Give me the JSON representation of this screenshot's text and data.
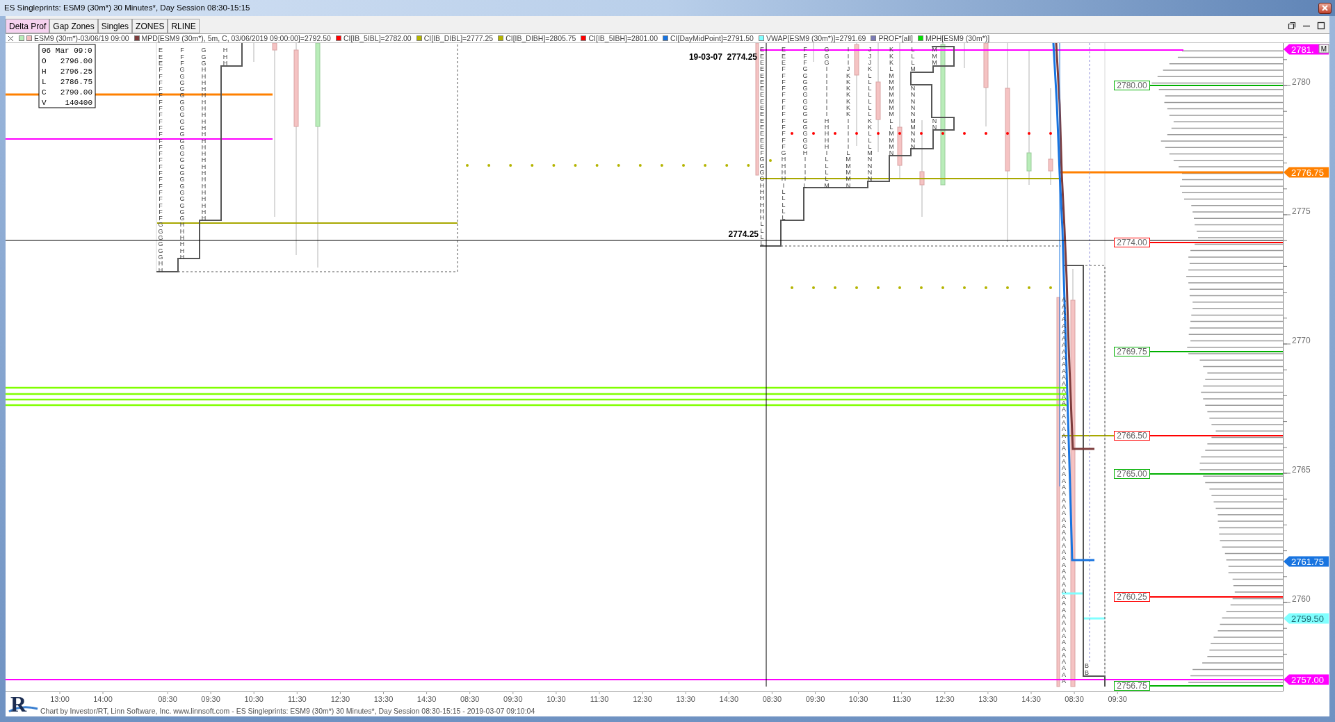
{
  "window": {
    "title": "ES Singleprints: ESM9 (30m*) 30 Minutes*, Day Session 08:30-15:15"
  },
  "toolbar": {
    "buttons": [
      {
        "label": "Delta Prof",
        "selected": true
      },
      {
        "label": "Gap Zones",
        "selected": false
      },
      {
        "label": "Singles",
        "selected": false
      },
      {
        "label": "ZONES",
        "selected": false
      },
      {
        "label": "RLINE",
        "selected": false
      }
    ]
  },
  "legend": {
    "items": [
      {
        "label": "ESM9 (30m*)-03/06/19 09:00",
        "swatches": [
          {
            "color": "#b8ecb8"
          },
          {
            "color": "#f4c0c0"
          }
        ]
      },
      {
        "label": "MPD[ESM9 (30m*), 5m, C, 03/06/2019 09:00:00]=2792.50",
        "swatches": [
          {
            "color": "#7d3c3c"
          }
        ]
      },
      {
        "label": "CI[IB_5IBL]=2782.00",
        "swatches": [
          {
            "color": "#ff0000"
          }
        ]
      },
      {
        "label": "CI[IB_DIBL]=2777.25",
        "swatches": [
          {
            "color": "#b4b400"
          }
        ]
      },
      {
        "label": "CI[IB_DIBH]=2805.75",
        "swatches": [
          {
            "color": "#b4b400"
          }
        ]
      },
      {
        "label": "CI[IB_5IBH]=2801.00",
        "swatches": [
          {
            "color": "#ff0000"
          }
        ]
      },
      {
        "label": "CI[DayMidPoint]=2791.50",
        "swatches": [
          {
            "color": "#1874e0"
          }
        ]
      },
      {
        "label": "VWAP[ESM9 (30m*)]=2791.69",
        "swatches": [
          {
            "color": "#80ffff"
          }
        ]
      },
      {
        "label": "PROF*[all]",
        "swatches": [
          {
            "color": "#7b7bb4"
          }
        ]
      },
      {
        "label": "MPH[ESM9 (30m*)]",
        "swatches": [
          {
            "color": "#00e000"
          }
        ]
      }
    ]
  },
  "chart": {
    "data_window": {
      "date": "06 Mar 09:0",
      "rows": [
        {
          "field": "O",
          "value": "2796.00"
        },
        {
          "field": "H",
          "value": "2796.25"
        },
        {
          "field": "L",
          "value": "2786.75"
        },
        {
          "field": "C",
          "value": "2790.00"
        },
        {
          "field": "V",
          "value": "140400"
        }
      ]
    },
    "profiles": [
      {
        "columns": [
          "EEEFFFFFFFFFFFFFFFFFFFFFFFFGGGGGGHH",
          "FFFGGGGGGGGGGGGGGGGGGGGGGGGHHHHHH",
          "GGGHHHHHHHHHHHHHHHHHHHHHHHH",
          "HHH"
        ]
      },
      {
        "columns": [
          "EEEEEEEEEEEEEEEEFGGGGHHHHHHLLLL",
          "EEEFFFFFFFFFFFFFGHHHHILLLLL",
          "FFFGGGGGGGGGGGGGHIIIIL",
          "GGGIIIIIIIIHHHHHILLLLM",
          "IIIJKKKKKKKIIIIILMMMMN",
          "JJJKLLLLLLLKKLLLMNNNN",
          "KKKLMMMMMMMLLMMMN",
          "LLLM",
          "NNNNNMMNNN",
          "MMM",
          "NN"
        ]
      },
      {
        "columns": [
          "AAAAAAAAAAAAAAAAAAAAAAAAAAAAAAAAAAAAAAAAAAAAAAAAAAAAAAAAAAAA",
          "BB"
        ]
      }
    ],
    "annotations": [
      {
        "text": "19-03-07  2774.25"
      },
      {
        "text": "2774.25"
      }
    ],
    "level_tags": [
      {
        "text": "2780.00",
        "color": "#00b000"
      },
      {
        "text": "2774.00",
        "color": "#ff0000"
      },
      {
        "text": "2769.75",
        "color": "#00b000"
      },
      {
        "text": "2766.50",
        "color": "#ff0000"
      },
      {
        "text": "2765.00",
        "color": "#00b000"
      },
      {
        "text": "2760.25",
        "color": "#ff0000"
      },
      {
        "text": "2756.75",
        "color": "#00b000"
      }
    ],
    "price_axis": {
      "ticks": [
        "2780",
        "2775",
        "2770",
        "2765",
        "2760"
      ],
      "tags": [
        {
          "text": "2781.",
          "color": "#ff00ff"
        },
        {
          "text": "2776.75",
          "color": "#ff8000"
        },
        {
          "text": "2761.75",
          "color": "#1874e0"
        },
        {
          "text": "2759.50",
          "color": "#80ffff"
        },
        {
          "text": "2757.00",
          "color": "#ff00ff"
        }
      ],
      "marker": "M"
    },
    "time_axis": {
      "labels": [
        "13:00",
        "14:00",
        "08:30",
        "09:30",
        "10:30",
        "11:30",
        "12:30",
        "13:30",
        "14:30",
        "08:30",
        "09:30",
        "10:30",
        "11:30",
        "12:30",
        "13:30",
        "14:30",
        "08:30",
        "09:30",
        "10:30",
        "11:30",
        "12:30",
        "13:30",
        "14:30",
        "08:30",
        "09:30"
      ]
    }
  },
  "footer": {
    "logo": "R",
    "text": "Chart by Investor/RT, Linn Software, Inc. www.linnsoft.com - ES Singleprints: ESM9 (30m*) 30 Minutes*, Day Session 08:30-15:15 - 2019-03-07 09:10:04"
  }
}
